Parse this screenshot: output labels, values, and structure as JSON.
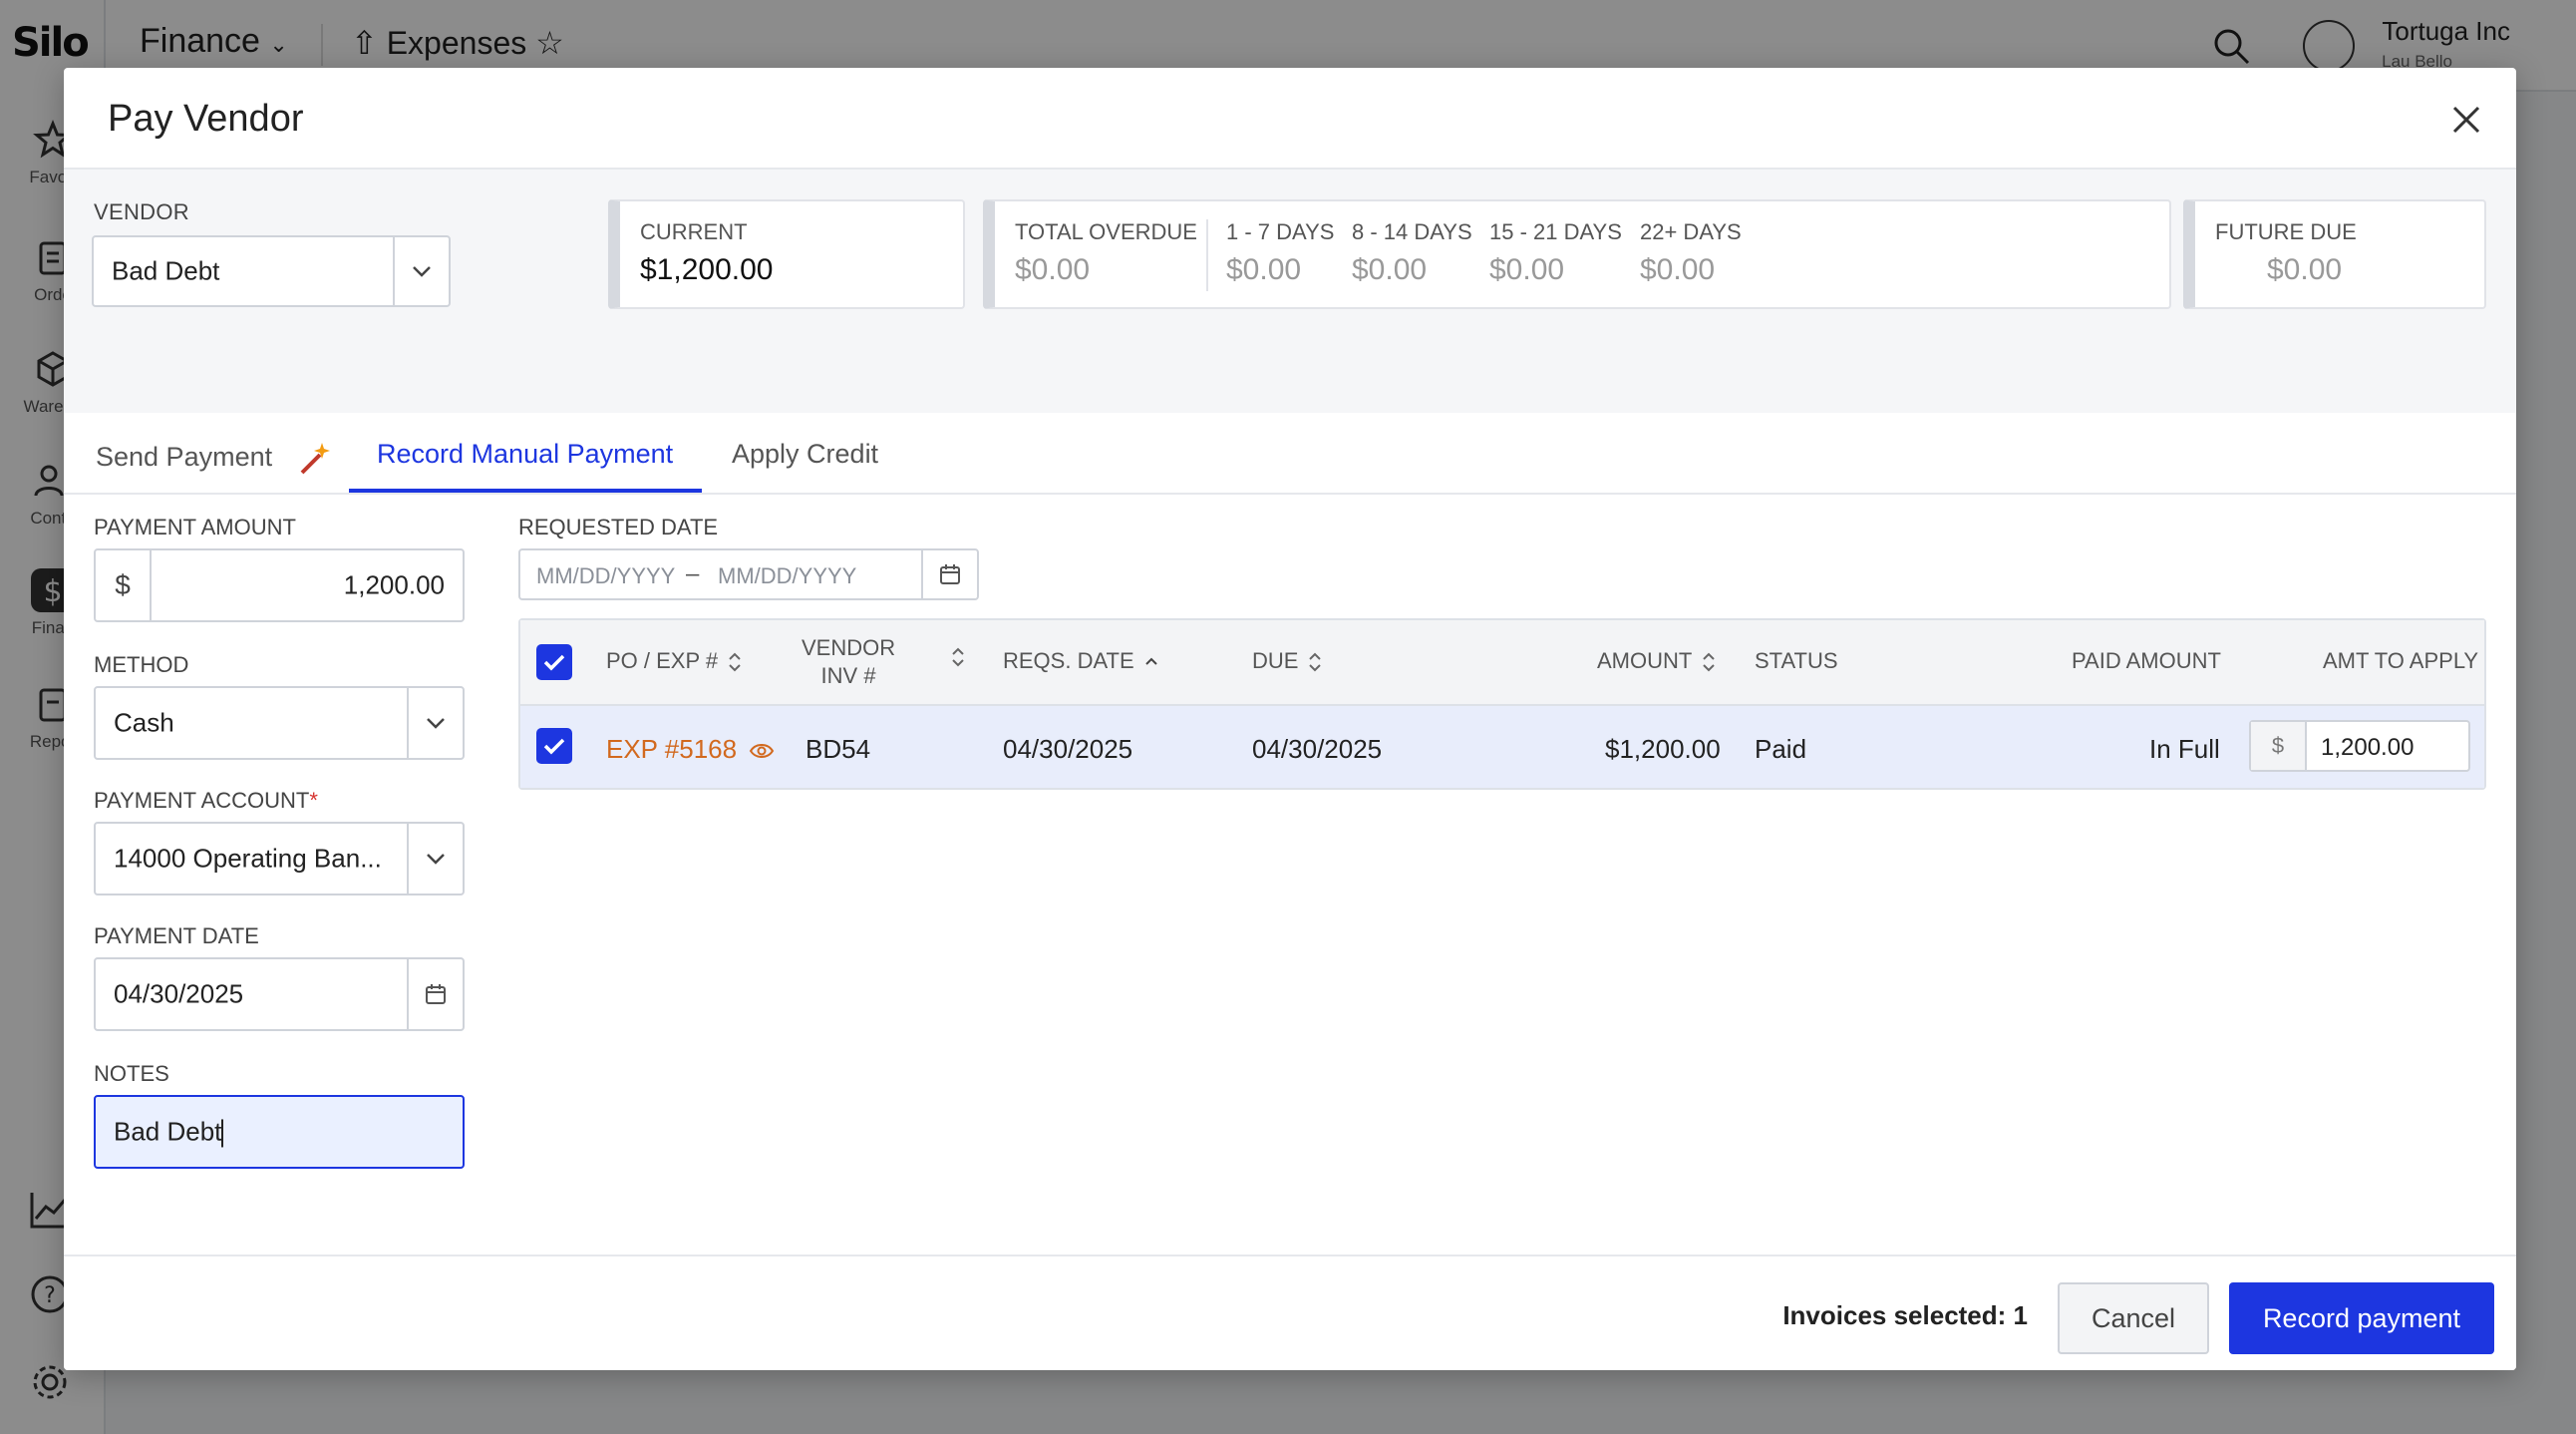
{
  "app": {
    "logo": "Silo",
    "section": "Finance",
    "page": "Expenses",
    "org": "Tortuga Inc",
    "user": "Lau Bello",
    "sidebar": [
      "Favori",
      "Orde",
      "Wareho",
      "Conta",
      "Finan",
      "Repor"
    ]
  },
  "modal": {
    "title": "Pay Vendor",
    "vendor_label": "VENDOR",
    "vendor_value": "Bad Debt",
    "current_label": "CURRENT",
    "current_value": "$1,200.00",
    "overdue": {
      "total_label": "TOTAL OVERDUE",
      "total_value": "$0.00",
      "d1_label": "1 - 7 DAYS",
      "d1_value": "$0.00",
      "d2_label": "8 - 14 DAYS",
      "d2_value": "$0.00",
      "d3_label": "15 - 21 DAYS",
      "d3_value": "$0.00",
      "d4_label": "22+ DAYS",
      "d4_value": "$0.00"
    },
    "future_label": "FUTURE DUE",
    "future_value": "$0.00",
    "tabs": [
      "Send Payment",
      "Record Manual Payment",
      "Apply Credit"
    ],
    "form": {
      "amount_label": "PAYMENT AMOUNT",
      "amount_prefix": "$",
      "amount_value": "1,200.00",
      "method_label": "METHOD",
      "method_value": "Cash",
      "account_label": "PAYMENT ACCOUNT",
      "account_value": "14000 Operating Ban...",
      "date_label": "PAYMENT DATE",
      "date_value": "04/30/2025",
      "notes_label": "NOTES",
      "notes_value": "Bad Debt"
    },
    "requested_date": {
      "label": "REQUESTED DATE",
      "from_placeholder": "MM/DD/YYYY",
      "sep": "–",
      "to_placeholder": "MM/DD/YYYY"
    },
    "table": {
      "headers": {
        "po": "PO / EXP #",
        "vendor_inv_1": "VENDOR",
        "vendor_inv_2": "INV #",
        "reqs_date": "REQS. DATE",
        "due": "DUE",
        "amount": "AMOUNT",
        "status": "STATUS",
        "paid_amount": "PAID AMOUNT",
        "amt_to_apply": "AMT TO APPLY"
      },
      "rows": [
        {
          "po": "EXP #5168",
          "vendor_inv": "BD54",
          "reqs_date": "04/30/2025",
          "due": "04/30/2025",
          "amount": "$1,200.00",
          "status": "Paid",
          "paid_amount": "In Full",
          "apply_prefix": "$",
          "apply_value": "1,200.00"
        }
      ]
    },
    "footer": {
      "invoices_selected": "Invoices selected: 1",
      "cancel": "Cancel",
      "record": "Record payment"
    }
  },
  "colors": {
    "accent": "#1d36e0",
    "link": "#d2691e",
    "star": "#d6332f"
  }
}
